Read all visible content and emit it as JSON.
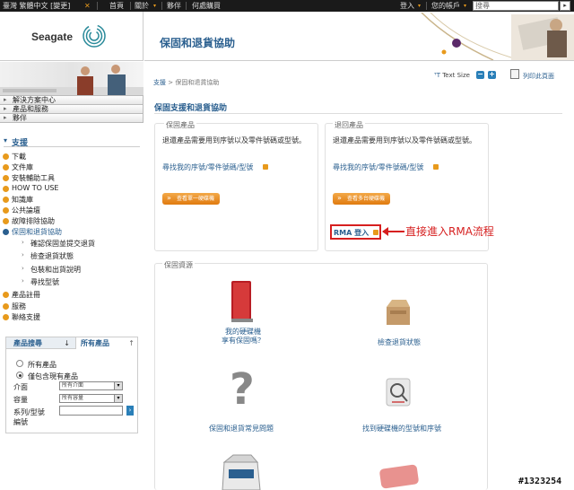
{
  "topbar": {
    "region": "臺灣 繁體中文 [變更]",
    "home": "首頁",
    "about": "關於",
    "partners": "夥伴",
    "where_to_buy": "何處購買",
    "login": "登入",
    "account": "您的帳戶",
    "search_value": "搜尋",
    "go_label": "▸"
  },
  "header": {
    "logo": "Seagate",
    "title": "保固和退貨協助"
  },
  "leftnav": {
    "tabs": [
      "解決方案中心",
      "產品和服務",
      "夥伴"
    ],
    "section_title": "支援",
    "items": [
      "下載",
      "文件庫",
      "安裝輔助工具",
      "HOW TO USE",
      "知識庫",
      "公共論壇",
      "故障排除協助",
      "保固和退貨協助"
    ],
    "subitems": [
      "確認保固並提交退貨",
      "檢查退貨狀態",
      "包裝和出貨說明",
      "尋找型號"
    ],
    "items_after": [
      "產品註冊",
      "服務",
      "聯絡支援"
    ]
  },
  "product_search": {
    "tab_active": "產品搜尋",
    "tab_active_arrow": "↓",
    "tab_other": "所有產品",
    "tab_other_arrow": "↑",
    "radio_all": "所有產品",
    "radio_current": "僅包含現有產品",
    "interface_label": "介面",
    "interface_value": "所有介面",
    "capacity_label": "容量",
    "capacity_value": "所有容量",
    "series_label_1": "系列/型號",
    "series_label_2": "編號",
    "series_value": "",
    "go_label": "›"
  },
  "main": {
    "breadcrumb_link": "支援",
    "breadcrumb_sep": ">",
    "breadcrumb_current": "保固和退貨協助",
    "text_size_label": "Text Size",
    "text_size_minus": "−",
    "text_size_plus": "+",
    "print_label": "列印此頁面",
    "page_title": "保固支援和退貨協助",
    "card_left": {
      "head": "保固產品",
      "desc": "退還產品需要用到序號以及零件號碼或型號。",
      "link": "尋找我的序號/零件號碼/型號",
      "button": "查看單一硬碟機"
    },
    "card_right": {
      "head": "退回產品",
      "desc": "退還產品需要用到序號以及零件號碼或型號。",
      "link": "尋找我的序號/零件號碼/型號",
      "button": "查看多台硬碟機",
      "rma_link": "RMA 登入"
    },
    "annotation": "直接進入RMA流程",
    "resources": {
      "head": "保固資源",
      "items": [
        {
          "line1": "我的硬碟機",
          "line2": "享有保固嗎？"
        },
        {
          "line1": "檢查退貨狀態",
          "line2": ""
        },
        {
          "line1": "保固和退貨常見問題",
          "line2": ""
        },
        {
          "line1": "找到硬碟機的型號和序號",
          "line2": ""
        }
      ]
    }
  },
  "watermark": "#1323254"
}
